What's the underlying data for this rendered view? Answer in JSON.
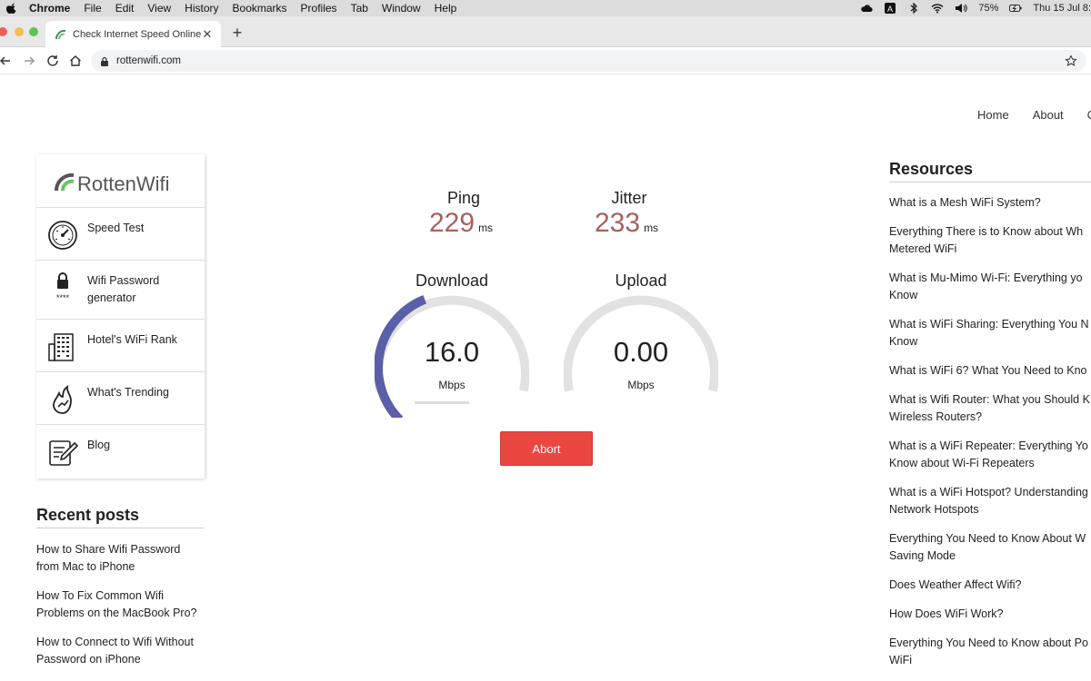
{
  "menubar": {
    "items": [
      "Chrome",
      "File",
      "Edit",
      "View",
      "History",
      "Bookmarks",
      "Profiles",
      "Tab",
      "Window",
      "Help"
    ],
    "battery": "75%",
    "datetime": "Thu 15 Jul  8:"
  },
  "browser": {
    "tab_title": "Check Internet Speed Online",
    "url": "rottenwifi.com"
  },
  "topnav": [
    "Home",
    "About",
    "C"
  ],
  "sidebar": {
    "logo_text": "RottenWifi",
    "items": [
      {
        "label": "Speed Test"
      },
      {
        "label_line1": "Wifi Password",
        "label_line2": "generator"
      },
      {
        "label": "Hotel's WiFi Rank"
      },
      {
        "label": "What's Trending"
      },
      {
        "label": "Blog"
      }
    ]
  },
  "recent": {
    "title": "Recent posts",
    "posts": [
      {
        "line1": "How to Share Wifi Password",
        "line2": "from Mac to iPhone"
      },
      {
        "line1": "How To Fix Common Wifi",
        "line2": "Problems on the MacBook Pro?"
      },
      {
        "line1": "How to Connect to Wifi Without",
        "line2": "Password on iPhone"
      }
    ]
  },
  "speedtest": {
    "ping_label": "Ping",
    "ping_value": "229",
    "ping_unit": "ms",
    "jitter_label": "Jitter",
    "jitter_value": "233",
    "jitter_unit": "ms",
    "download_label": "Download",
    "download_value": "16.0",
    "download_unit": "Mbps",
    "download_gauge_fraction": 0.42,
    "upload_label": "Upload",
    "upload_value": "0.00",
    "upload_unit": "Mbps",
    "upload_gauge_fraction": 0,
    "abort_label": "Abort",
    "colors": {
      "gauge_fill": "#5b5fa8",
      "gauge_track": "#e2e2e2",
      "value": "#a86060",
      "abort": "#e94740"
    }
  },
  "resources": {
    "title": "Resources",
    "items": [
      {
        "line1": "What is a Mesh WiFi System?"
      },
      {
        "line1": "Everything There is to Know about Wh",
        "line2": "Metered WiFi"
      },
      {
        "line1": "What is Mu-Mimo Wi-Fi: Everything yo",
        "line2": "Know"
      },
      {
        "line1": "What is WiFi Sharing: Everything You N",
        "line2": "Know"
      },
      {
        "line1": "What is WiFi 6? What You Need to Kno"
      },
      {
        "line1": "What is Wifi Router: What you Should K",
        "line2": "Wireless Routers?"
      },
      {
        "line1": "What is a WiFi Repeater: Everything Yo",
        "line2": "Know about Wi-Fi Repeaters"
      },
      {
        "line1": "What is a WiFi Hotspot? Understanding",
        "line2": "Network Hotspots"
      },
      {
        "line1": "Everything You Need to Know About W",
        "line2": "Saving Mode"
      },
      {
        "line1": "Does Weather Affect Wifi?"
      },
      {
        "line1": "How Does WiFi Work?"
      },
      {
        "line1": "Everything You Need to Know about Po",
        "line2": "WiFi"
      }
    ]
  }
}
